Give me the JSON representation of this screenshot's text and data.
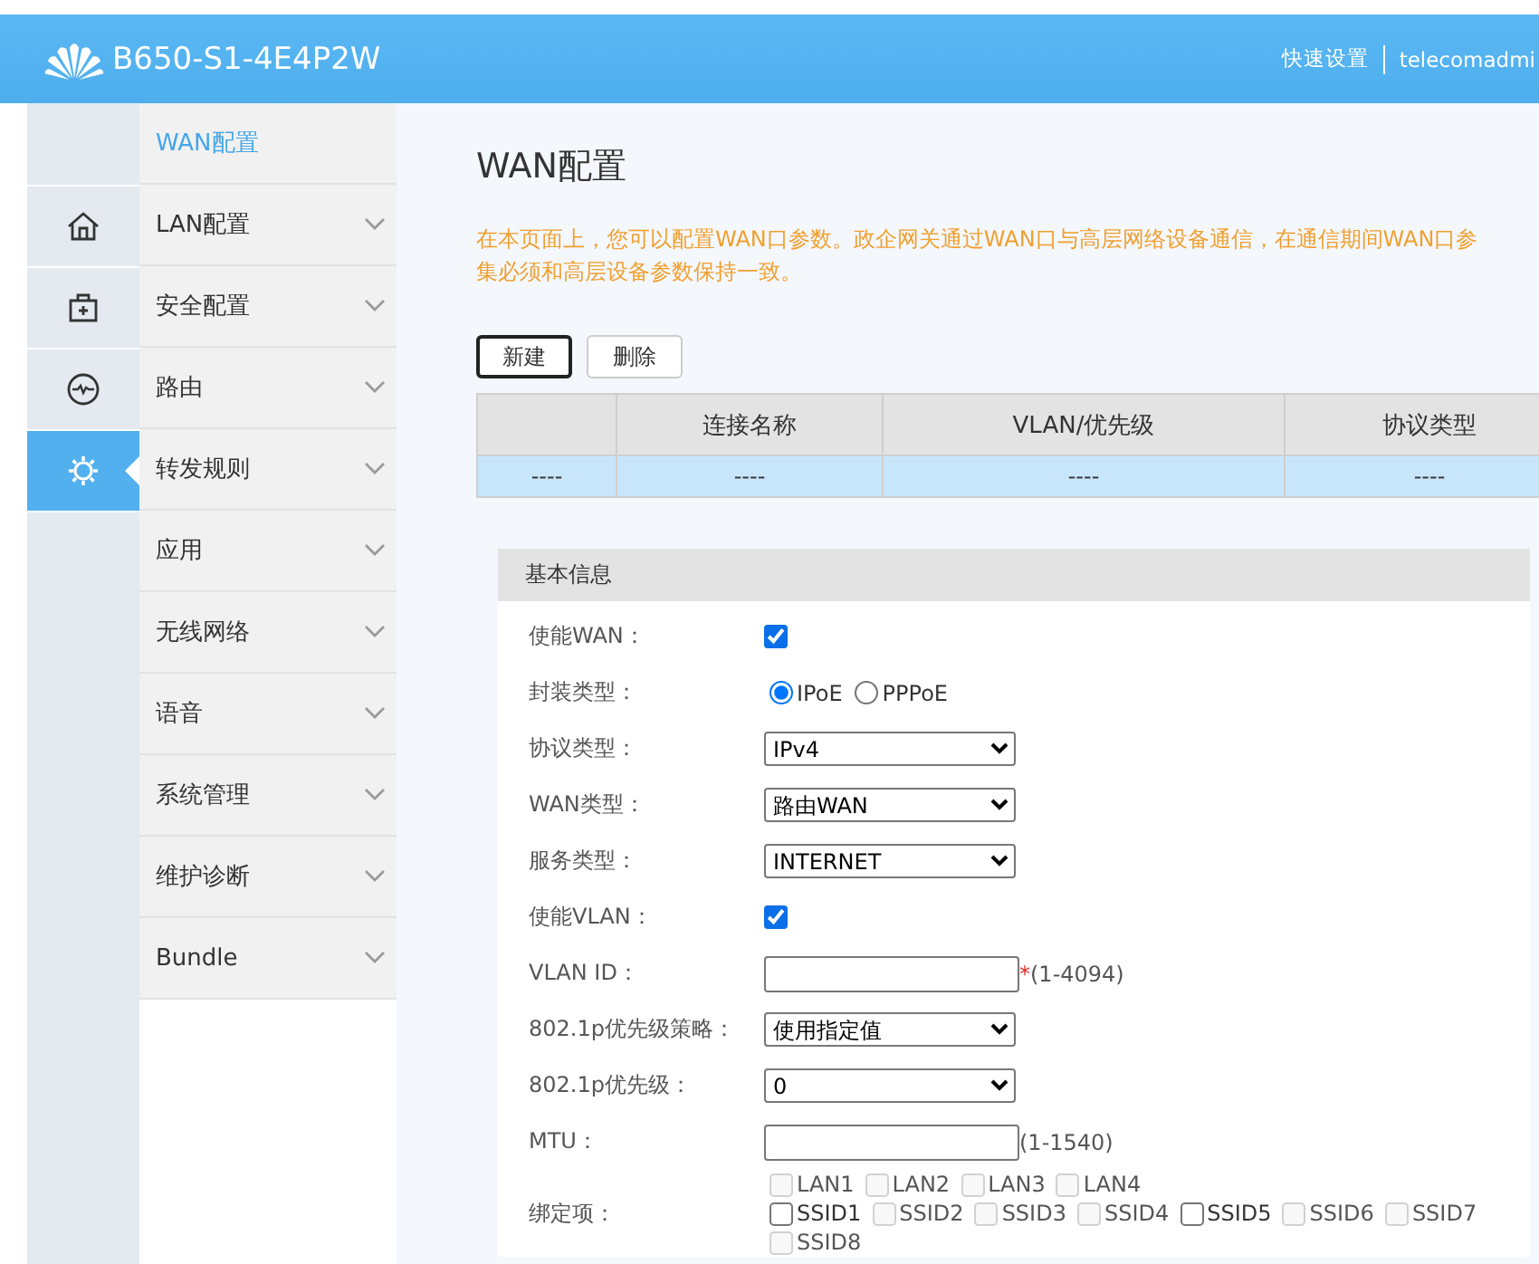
{
  "header": {
    "device_name": "B650-S1-4E4P2W",
    "links": [
      "快速设置",
      "telecomadmi"
    ]
  },
  "icon_rail": [
    {
      "selected": false
    },
    {
      "selected": false
    },
    {
      "selected": false
    },
    {
      "selected": true
    }
  ],
  "nav": [
    {
      "label": "WAN配置",
      "selected": true,
      "kind": "page"
    },
    {
      "label": "LAN配置",
      "selected": false,
      "kind": "group"
    },
    {
      "label": "安全配置",
      "selected": false,
      "kind": "group"
    },
    {
      "label": "路由",
      "selected": false,
      "kind": "group"
    },
    {
      "label": "转发规则",
      "selected": false,
      "kind": "group"
    },
    {
      "label": "应用",
      "selected": false,
      "kind": "group"
    },
    {
      "label": "无线网络",
      "selected": false,
      "kind": "group"
    },
    {
      "label": "语音",
      "selected": false,
      "kind": "group"
    },
    {
      "label": "系统管理",
      "selected": false,
      "kind": "group"
    },
    {
      "label": "维护诊断",
      "selected": false,
      "kind": "group"
    },
    {
      "label": "Bundle",
      "selected": false,
      "kind": "group"
    }
  ],
  "page": {
    "title": "WAN配置",
    "description": [
      "在本页面上，您可以配置WAN口参数。政企网关通过WAN口与高层网络设备通信，在通信期间WAN口参",
      "集必须和高层设备参数保持一致。"
    ]
  },
  "buttons": [
    {
      "label": "新建",
      "focused": true
    },
    {
      "label": "删除",
      "focused": false
    }
  ],
  "table": {
    "columns": [
      "",
      "连接名称",
      "VLAN/优先级",
      "协议类型"
    ],
    "rows": [
      {
        "selected": true,
        "cells": [
          "----",
          "----",
          "----",
          "----"
        ]
      }
    ]
  },
  "form": {
    "section_title": "基本信息",
    "fields": [
      {
        "kind": "checkbox",
        "label": "使能WAN：",
        "checked": true
      },
      {
        "kind": "radio",
        "label": "封装类型：",
        "options": [
          {
            "label": "IPoE",
            "selected": true
          },
          {
            "label": "PPPoE",
            "selected": false
          }
        ]
      },
      {
        "kind": "select",
        "label": "协议类型：",
        "value": "IPv4"
      },
      {
        "kind": "select",
        "label": "WAN类型：",
        "value": "路由WAN"
      },
      {
        "kind": "select",
        "label": "服务类型：",
        "value": "INTERNET"
      },
      {
        "kind": "checkbox",
        "label": "使能VLAN：",
        "checked": true
      },
      {
        "kind": "input",
        "label": "VLAN ID：",
        "required_mark": "*",
        "hint": "(1-4094)"
      },
      {
        "kind": "select",
        "label": "802.1p优先级策略：",
        "value": "使用指定值"
      },
      {
        "kind": "select",
        "label": "802.1p优先级：",
        "value": "0"
      },
      {
        "kind": "input",
        "label": "MTU：",
        "hint": "(1-1540)"
      },
      {
        "kind": "checks",
        "label": "绑定项：",
        "lines": [
          [
            {
              "label": "LAN1",
              "checked": false,
              "disabled": true
            },
            {
              "label": "LAN2",
              "checked": false,
              "disabled": true
            },
            {
              "label": "LAN3",
              "checked": false,
              "disabled": true
            },
            {
              "label": "LAN4",
              "checked": false,
              "disabled": true
            }
          ],
          [
            {
              "label": "SSID1",
              "checked": false,
              "disabled": false
            },
            {
              "label": "SSID2",
              "checked": false,
              "disabled": true
            },
            {
              "label": "SSID3",
              "checked": false,
              "disabled": true
            },
            {
              "label": "SSID4",
              "checked": false,
              "disabled": true
            },
            {
              "label": "SSID5",
              "checked": false,
              "disabled": false
            },
            {
              "label": "SSID6",
              "checked": false,
              "disabled": true
            },
            {
              "label": "SSID7",
              "checked": false,
              "disabled": true
            },
            {
              "label": "SSID8",
              "checked": false,
              "disabled": true
            }
          ]
        ]
      }
    ]
  }
}
